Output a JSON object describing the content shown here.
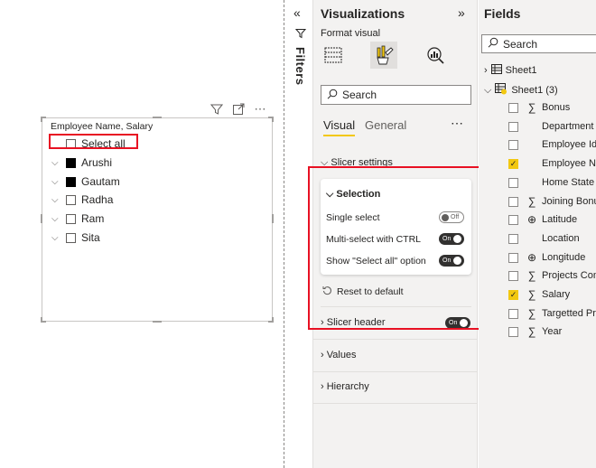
{
  "canvas": {
    "slicer": {
      "title": "Employee Name, Salary",
      "items": [
        {
          "label": "Select all",
          "checked": false,
          "has_chevron": false
        },
        {
          "label": "Arushi",
          "checked": true,
          "has_chevron": true
        },
        {
          "label": "Gautam",
          "checked": true,
          "has_chevron": true
        },
        {
          "label": "Radha",
          "checked": false,
          "has_chevron": true
        },
        {
          "label": "Ram",
          "checked": false,
          "has_chevron": true
        },
        {
          "label": "Sita",
          "checked": false,
          "has_chevron": true
        }
      ]
    },
    "header_icons": [
      "filter-icon",
      "focus-mode-icon",
      "more-options-icon"
    ]
  },
  "filters": {
    "label": "Filters"
  },
  "visualizations": {
    "title": "Visualizations",
    "format_label": "Format visual",
    "search_placeholder": "Search",
    "tabs": {
      "visual": "Visual",
      "general": "General"
    },
    "sections": {
      "slicer_settings": "Slicer settings",
      "selection": {
        "title": "Selection",
        "options": [
          {
            "label": "Single select",
            "state": "Off"
          },
          {
            "label": "Multi-select with CTRL",
            "state": "On"
          },
          {
            "label": "Show \"Select all\" option",
            "state": "On"
          }
        ]
      },
      "reset": "Reset to default",
      "slicer_header": {
        "label": "Slicer header",
        "state": "On"
      },
      "values": "Values",
      "hierarchy": "Hierarchy"
    }
  },
  "fields": {
    "title": "Fields",
    "search_placeholder": "Search",
    "tables": [
      {
        "label": "Sheet1",
        "expanded": false
      },
      {
        "label": "Sheet1 (3)",
        "expanded": true
      }
    ],
    "items": [
      {
        "label": "Bonus",
        "icon": "sigma-icon",
        "checked": false
      },
      {
        "label": "Department",
        "icon": "",
        "checked": false
      },
      {
        "label": "Employee Id",
        "icon": "",
        "checked": false
      },
      {
        "label": "Employee Nam",
        "icon": "",
        "checked": true
      },
      {
        "label": "Home State",
        "icon": "",
        "checked": false
      },
      {
        "label": "Joining Bonus",
        "icon": "sigma-icon",
        "checked": false
      },
      {
        "label": "Latitude",
        "icon": "globe-icon",
        "checked": false
      },
      {
        "label": "Location",
        "icon": "",
        "checked": false
      },
      {
        "label": "Longitude",
        "icon": "globe-icon",
        "checked": false
      },
      {
        "label": "Projects Comp",
        "icon": "sigma-icon",
        "checked": false
      },
      {
        "label": "Salary",
        "icon": "sigma-icon",
        "checked": true
      },
      {
        "label": "Targetted Proj",
        "icon": "sigma-icon",
        "checked": false
      },
      {
        "label": "Year",
        "icon": "sigma-icon",
        "checked": false
      }
    ]
  },
  "colors": {
    "accent": "#f2c811",
    "highlight": "#e81123",
    "pane_bg": "#f3f2f1"
  }
}
